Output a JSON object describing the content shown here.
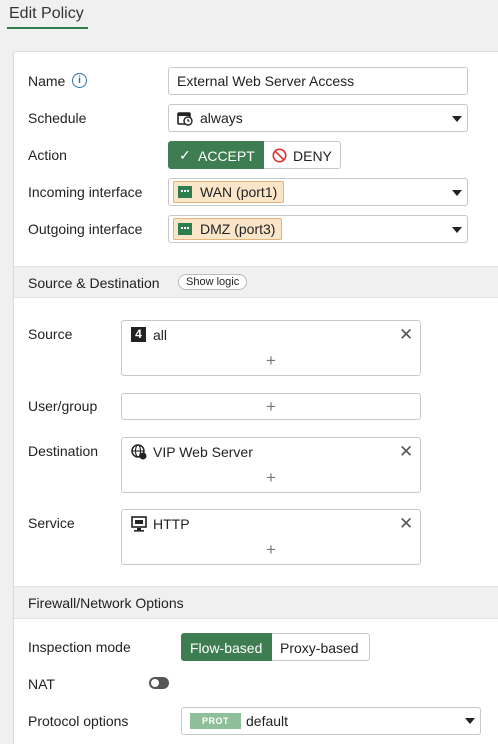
{
  "header": {
    "title": "Edit Policy"
  },
  "form": {
    "name_label": "Name",
    "name_info_glyph": "i",
    "name_value": "External Web Server Access",
    "schedule_label": "Schedule",
    "schedule_value": "always",
    "action_label": "Action",
    "accept_label": "ACCEPT",
    "accept_glyph": "✓",
    "deny_label": "DENY",
    "incoming_label": "Incoming interface",
    "incoming_value": "WAN (port1)",
    "outgoing_label": "Outgoing interface",
    "outgoing_value": "DMZ (port3)"
  },
  "source_section": {
    "title": "Source & Destination",
    "show_logic": "Show logic",
    "source_label": "Source",
    "source_value": "all",
    "source_icon_glyph": "4",
    "user_label": "User/group",
    "destination_label": "Destination",
    "destination_value": "VIP Web Server",
    "service_label": "Service",
    "service_value": "HTTP",
    "remove_glyph": "✕",
    "add_glyph": "+"
  },
  "firewall_section": {
    "title": "Firewall/Network Options",
    "inspection_label": "Inspection mode",
    "mode_flow": "Flow-based",
    "mode_proxy": "Proxy-based",
    "nat_label": "NAT",
    "nat_enabled": false,
    "protocol_label": "Protocol options",
    "protocol_badge": "PROT",
    "protocol_value": "default"
  },
  "colors": {
    "accent_green": "#3e7d52",
    "tag_bg": "#fbe5c8",
    "deny_red": "#d9342b",
    "info_blue": "#2a6fb0"
  },
  "icons": {
    "name_info": "info-icon",
    "schedule": "calendar-clock-icon",
    "deny": "prohibited-icon",
    "interface": "network-port-icon",
    "source": "address-icon",
    "destination": "globe-vip-icon",
    "service": "monitor-icon"
  }
}
